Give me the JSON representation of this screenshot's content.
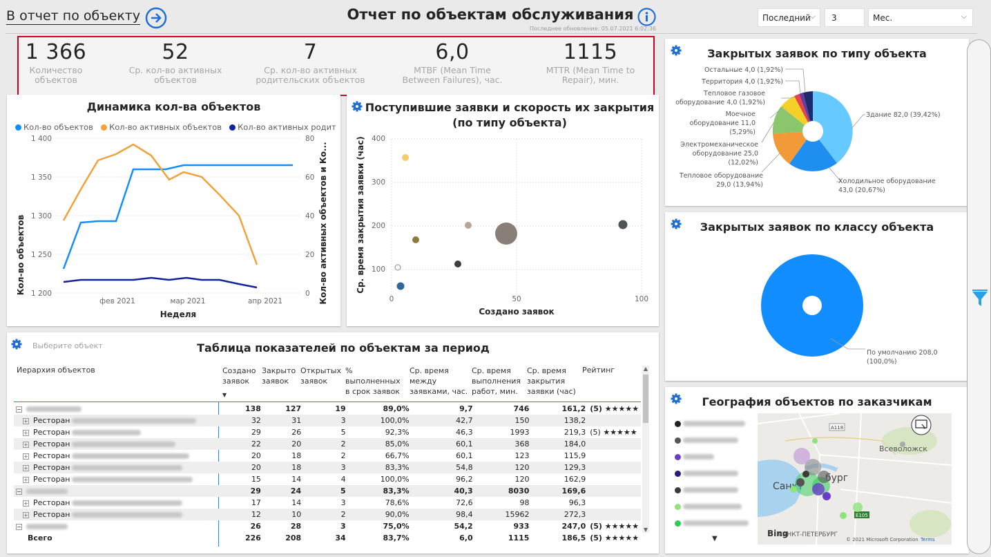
{
  "header": {
    "back_link": "В отчет по объекту",
    "title": "Отчет по объектам обслуживания",
    "last_update": "Последнее обновление: 05.07.2021 6:02:36",
    "filter_period": "Последний",
    "filter_count": "3",
    "filter_unit": "Мес."
  },
  "kpis": [
    {
      "value": "1 366",
      "label": "Количество объектов"
    },
    {
      "value": "52",
      "label": "Ср. кол-во активных объектов"
    },
    {
      "value": "7",
      "label": "Ср. кол-во активных родительских объектов"
    },
    {
      "value": "6,0",
      "label": "MTBF (Mean Time Between Failures), час."
    },
    {
      "value": "1115",
      "label": "MTTR (Mean Time to Repair), мин."
    }
  ],
  "colors": {
    "blue": "#118dff",
    "orange": "#f0a23b",
    "navy": "#12239e",
    "accent": "#1f6ed4",
    "kpi_border": "#d0021b"
  },
  "line_chart": {
    "title": "Динамика кол-ва объектов",
    "legend": [
      "Кол-во объектов",
      "Кол-во активных объектов",
      "Кол-во активных родительс..."
    ],
    "xlabel": "Неделя",
    "ylabel_left": "Кол-во объектов",
    "ylabel_right": "Кол-во активных объектов и Ко...",
    "x_ticks": [
      "фев 2021",
      "мар 2021",
      "апр 2021"
    ],
    "y_left_ticks": [
      "1 400",
      "1 350",
      "1 300",
      "1 250",
      "1 200"
    ],
    "y_right_ticks": [
      "80",
      "60",
      "40",
      "20",
      "0"
    ]
  },
  "scatter": {
    "title_line1": "Поступившие заявки и скорость их закрытия",
    "title_line2": "(по типу объекта)",
    "xlabel": "Создано заявок",
    "ylabel": "Ср. время закрытия заявки (час)",
    "x_ticks": [
      "0",
      "50",
      "100"
    ],
    "y_ticks": [
      "400",
      "300",
      "200",
      "100"
    ]
  },
  "pie_type": {
    "title": "Закрытых заявок по типу объекта",
    "labels": [
      "Остальные 4,0 (1,92%)",
      "Территория 4,0 (1,92%)",
      "Тепловое газовое",
      "оборудование 4,0 (1,92%)",
      "Моечное",
      "оборудование 11,0",
      "(5,29%)",
      "Электромеханическое",
      "оборудование 25,0",
      "(12,02%)",
      "Тепловое оборудование",
      "29,0 (13,94%)",
      "Здание 82,0 (39,42%)",
      "Холодильное оборудование",
      "43,0 (20,67%)"
    ]
  },
  "pie_class": {
    "title": "Закрытых заявок по классу объекта",
    "label1": "По умолчанию 208,0",
    "label2": "(100,0%)"
  },
  "map": {
    "title": "География объектов по заказчикам",
    "city": "Санкт-Петербург",
    "city_label_left": "Санкт",
    "city_label_right": "бург",
    "vsevolozhsk": "Всеволожск",
    "city_bottom": "САНКТ-ПЕТЕРБУРГ",
    "road1": "A118",
    "road2": "E105",
    "bing": "Bing",
    "copyright": "© 2021 Microsoft Corporation",
    "terms": "Terms"
  },
  "table": {
    "title": "Таблица показателей по объектам за период",
    "slicer_placeholder": "Выберите объект",
    "headers": [
      "Иерархия объектов",
      "Создано заявок",
      "Закрыто заявок",
      "Открытых заявок",
      "% выполненных в срок заявок",
      "Ср. время между заявками, час.",
      "Ср. время выполнения работ, мин.",
      "Ср. время закрытия заявки (час)",
      "Рейтинг"
    ],
    "prefix": "Ресторан",
    "rows": [
      {
        "lvl": 0,
        "c": "138",
        "z": "127",
        "o": "19",
        "p": "89,0%",
        "m": "9,7",
        "w": "746",
        "cl": "161,2",
        "r": "(5) ★★★★★"
      },
      {
        "lvl": 1,
        "c": "32",
        "z": "31",
        "o": "3",
        "p": "100,0%",
        "m": "42,7",
        "w": "150",
        "cl": "138,2",
        "r": ""
      },
      {
        "lvl": 1,
        "c": "29",
        "z": "26",
        "o": "5",
        "p": "92,3%",
        "m": "46,3",
        "w": "1993",
        "cl": "219,3",
        "r": "(5) ★★★★★"
      },
      {
        "lvl": 1,
        "c": "22",
        "z": "20",
        "o": "2",
        "p": "85,0%",
        "m": "60,1",
        "w": "368",
        "cl": "184,0",
        "r": ""
      },
      {
        "lvl": 1,
        "c": "20",
        "z": "18",
        "o": "2",
        "p": "66,7%",
        "m": "60,1",
        "w": "123",
        "cl": "115,9",
        "r": ""
      },
      {
        "lvl": 1,
        "c": "20",
        "z": "18",
        "o": "3",
        "p": "83,3%",
        "m": "54,8",
        "w": "120",
        "cl": "129,3",
        "r": ""
      },
      {
        "lvl": 1,
        "c": "15",
        "z": "14",
        "o": "4",
        "p": "100,0%",
        "m": "96,2",
        "w": "120",
        "cl": "162,9",
        "r": ""
      },
      {
        "lvl": 0,
        "c": "29",
        "z": "24",
        "o": "5",
        "p": "83,3%",
        "m": "40,3",
        "w": "8030",
        "cl": "169,6",
        "r": ""
      },
      {
        "lvl": 1,
        "c": "17",
        "z": "14",
        "o": "3",
        "p": "78,6%",
        "m": "72,6",
        "w": "98",
        "cl": "96,3",
        "r": ""
      },
      {
        "lvl": 1,
        "c": "12",
        "z": "10",
        "o": "2",
        "p": "90,0%",
        "m": "98,4",
        "w": "15962",
        "cl": "272,3",
        "r": ""
      },
      {
        "lvl": 0,
        "c": "26",
        "z": "28",
        "o": "3",
        "p": "75,0%",
        "m": "54,2",
        "w": "933",
        "cl": "247,0",
        "r": "(5) ★★★★★"
      }
    ],
    "total": {
      "label": "Всего",
      "c": "226",
      "z": "208",
      "o": "34",
      "p": "83,7%",
      "m": "6,0",
      "w": "1115",
      "cl": "186,5",
      "r": "(5) ★★★★★"
    }
  }
}
